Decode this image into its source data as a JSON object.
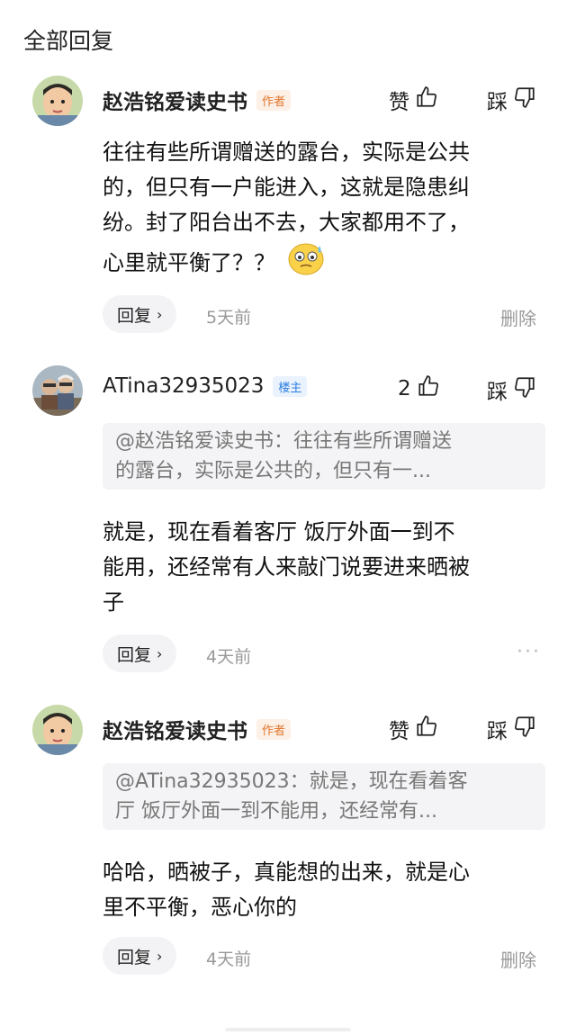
{
  "section_title": "全部回复",
  "comments": [
    {
      "username": "赵浩铭爱读史书",
      "badge": "作者",
      "like_label": "赞",
      "dislike_label": "踩",
      "body_lines": [
        "往往有些所谓赠送的露台，实际是公共",
        "的，但只有一户能进入，这就是隐患纠",
        "纷。封了阳台出不去，大家都用不了，",
        "心里就平衡了？？"
      ],
      "reply_label": "回复",
      "time": "5天前",
      "action": "删除"
    },
    {
      "username": "ATina32935023",
      "badge": "楼主",
      "like_count": "2",
      "dislike_label": "踩",
      "quote_lines": [
        "@赵浩铭爱读史书：往往有些所谓赠送",
        "的露台，实际是公共的，但只有一..."
      ],
      "body_lines": [
        "就是，现在看着客厅 饭厅外面一到不",
        "能用，还经常有人来敲门说要进来晒被",
        "子"
      ],
      "reply_label": "回复",
      "time": "4天前",
      "action": "···"
    },
    {
      "username": "赵浩铭爱读史书",
      "badge": "作者",
      "like_label": "赞",
      "dislike_label": "踩",
      "quote_lines": [
        "@ATina32935023：就是，现在看着客",
        "厅 饭厅外面一到不能用，还经常有..."
      ],
      "body_lines": [
        "哈哈，晒被子，真能想的出来，就是心",
        "里不平衡，恶心你的"
      ],
      "reply_label": "回复",
      "time": "4天前",
      "action": "删除"
    }
  ],
  "colors": {
    "author_badge": "#e0762e",
    "owner_badge": "#2a7de1",
    "muted_text": "#999999",
    "quote_bg": "#f4f4f6"
  }
}
